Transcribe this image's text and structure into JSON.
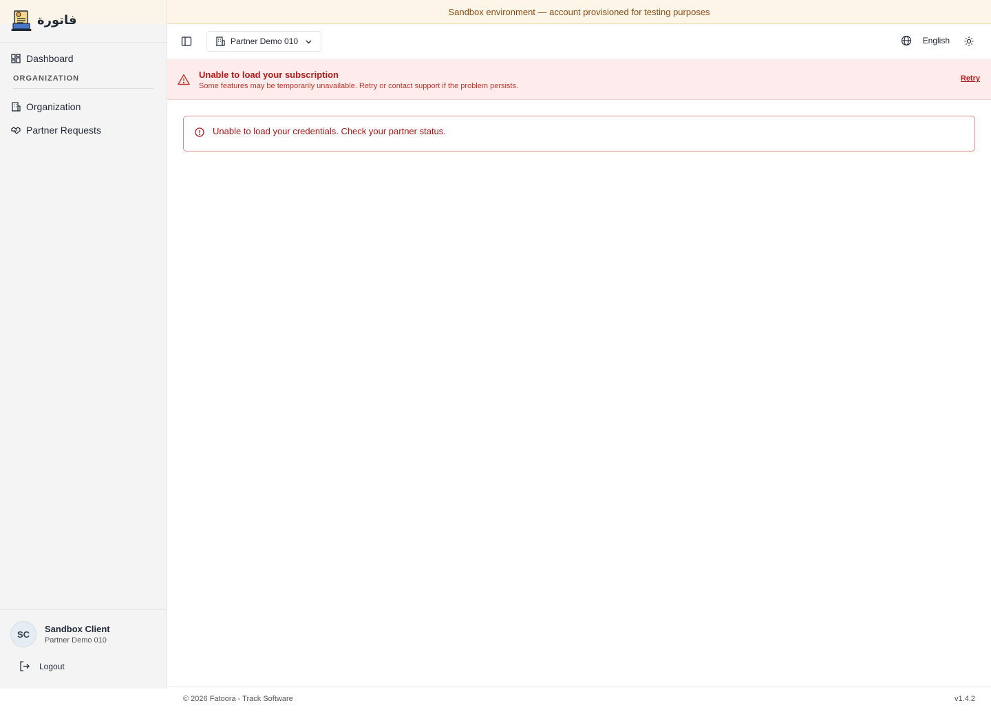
{
  "brand": {
    "name": "فاتورة",
    "logo_icon": "invoice-laptop-icon"
  },
  "sidebar": {
    "items": [
      {
        "label": "Dashboard",
        "icon": "dashboard-grid-icon"
      },
      {
        "label": "Organization",
        "icon": "building-icon"
      },
      {
        "label": "Partner Requests",
        "icon": "handshake-icon"
      }
    ],
    "section_label": "ORGANIZATION",
    "user": {
      "initials": "SC",
      "name": "Sandbox Client",
      "org": "Partner Demo 010"
    },
    "logout_label": "Logout"
  },
  "sandbox_banner": {
    "text": "Sandbox environment — account provisioned for testing purposes"
  },
  "header": {
    "org_selector": "Partner Demo 010",
    "language": "English"
  },
  "subscription_error": {
    "title": "Unable to load your subscription",
    "message": "Some features may be temporarily unavailable. Retry or contact support if the problem persists.",
    "retry_label": "Retry"
  },
  "credentials_alert": {
    "text": "Unable to load your credentials. Check your partner status."
  },
  "footer": {
    "copyright": "© 2026 Fatoora - Track Software",
    "version": "v1.4.2"
  },
  "colors": {
    "error": "#b31b1b",
    "sandbox_text": "#8a4b12",
    "sandbox_bg": "#fdf5e8",
    "error_bg": "#fdeceb"
  }
}
